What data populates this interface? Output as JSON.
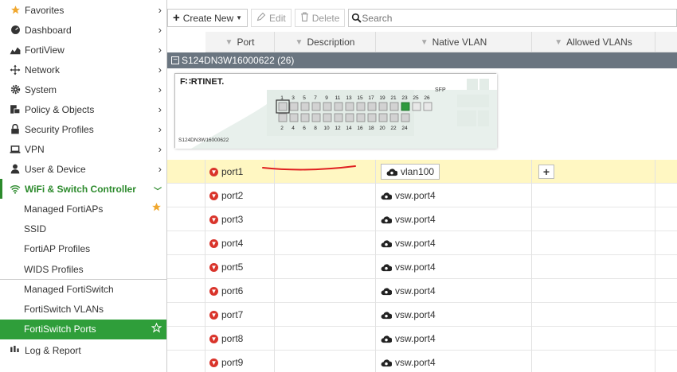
{
  "sidebar": {
    "items": [
      {
        "label": "Favorites",
        "icon": "star-icon"
      },
      {
        "label": "Dashboard",
        "icon": "dashboard-icon"
      },
      {
        "label": "FortiView",
        "icon": "chart-icon"
      },
      {
        "label": "Network",
        "icon": "network-icon"
      },
      {
        "label": "System",
        "icon": "gear-icon"
      },
      {
        "label": "Policy & Objects",
        "icon": "policy-icon"
      },
      {
        "label": "Security Profiles",
        "icon": "lock-icon"
      },
      {
        "label": "VPN",
        "icon": "laptop-icon"
      },
      {
        "label": "User & Device",
        "icon": "user-icon"
      },
      {
        "label": "WiFi & Switch Controller",
        "icon": "wifi-icon"
      }
    ],
    "sub_items": [
      {
        "label": "Managed FortiAPs"
      },
      {
        "label": "SSID"
      },
      {
        "label": "FortiAP Profiles"
      },
      {
        "label": "WIDS Profiles"
      },
      {
        "label": "Managed FortiSwitch"
      },
      {
        "label": "FortiSwitch VLANs"
      },
      {
        "label": "FortiSwitch Ports"
      }
    ],
    "next_item": {
      "label": "Log & Report"
    }
  },
  "toolbar": {
    "create_label": "Create New",
    "edit_label": "Edit",
    "delete_label": "Delete",
    "search_placeholder": "Search"
  },
  "table": {
    "headers": {
      "port": "Port",
      "description": "Description",
      "native_vlan": "Native VLAN",
      "allowed_vlans": "Allowed VLANs"
    },
    "group_label": "S124DN3W16000622 (26)",
    "faceplate": {
      "brand": "F∷RTINET.",
      "serial": "S124DN3W16000622",
      "sfp": "SFP",
      "top_nums": [
        "1",
        "3",
        "5",
        "7",
        "9",
        "11",
        "13",
        "15",
        "17",
        "19",
        "21",
        "23",
        "25",
        "26"
      ],
      "bottom_nums": [
        "2",
        "4",
        "6",
        "8",
        "10",
        "12",
        "14",
        "16",
        "18",
        "20",
        "22",
        "24"
      ]
    },
    "rows": [
      {
        "port": "port1",
        "description": "",
        "native_vlan": "vlan100",
        "allowed": "+"
      },
      {
        "port": "port2",
        "description": "",
        "native_vlan": "vsw.port4",
        "allowed": ""
      },
      {
        "port": "port3",
        "description": "",
        "native_vlan": "vsw.port4",
        "allowed": ""
      },
      {
        "port": "port4",
        "description": "",
        "native_vlan": "vsw.port4",
        "allowed": ""
      },
      {
        "port": "port5",
        "description": "",
        "native_vlan": "vsw.port4",
        "allowed": ""
      },
      {
        "port": "port6",
        "description": "",
        "native_vlan": "vsw.port4",
        "allowed": ""
      },
      {
        "port": "port7",
        "description": "",
        "native_vlan": "vsw.port4",
        "allowed": ""
      },
      {
        "port": "port8",
        "description": "",
        "native_vlan": "vsw.port4",
        "allowed": ""
      },
      {
        "port": "port9",
        "description": "",
        "native_vlan": "vsw.port4",
        "allowed": ""
      }
    ]
  },
  "colors": {
    "active_green": "#2f9e3a",
    "highlight_row": "#fff7c2",
    "annotation_red": "#e02020",
    "group_bar": "#6a7580"
  }
}
